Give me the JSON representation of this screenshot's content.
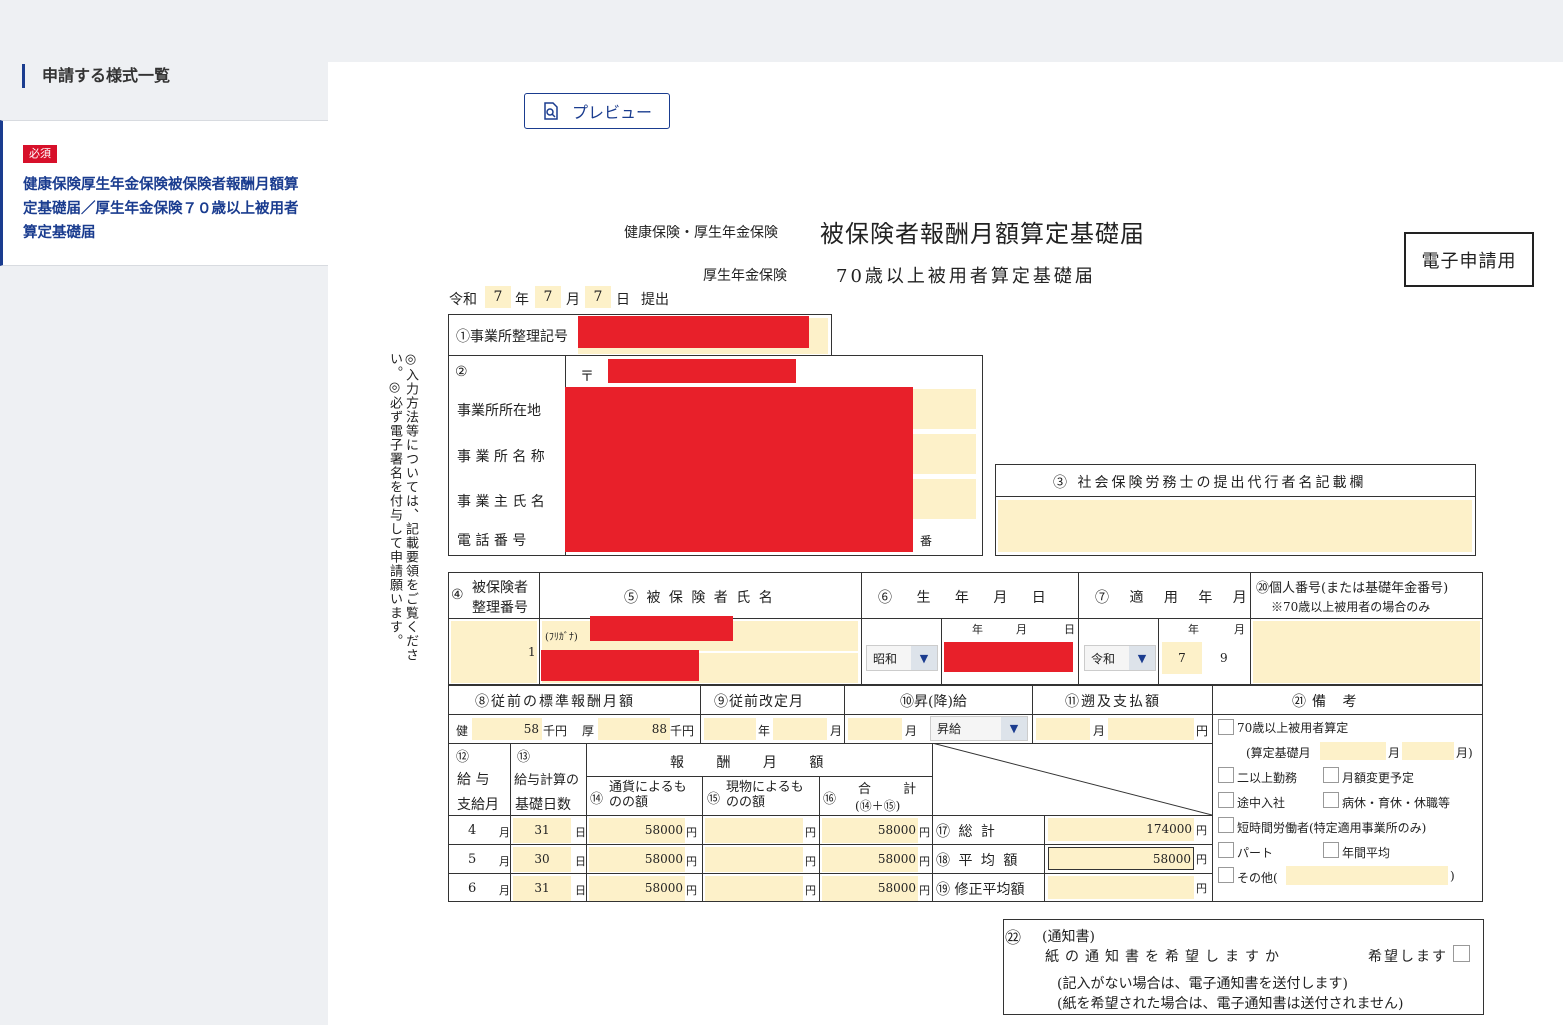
{
  "sidebar": {
    "heading": "申請する様式一覧",
    "badge": "必須",
    "form_link": "健康保険厚生年金保険被保険者報酬月額算定基礎届／厚生年金保険７０歳以上被用者算定基礎届"
  },
  "toolbar": {
    "preview_label": "プレビュー"
  },
  "form": {
    "title_prefix": "健康保険・厚生年金保険",
    "title_main": "被保険者報酬月額算定基礎届",
    "subtitle_prefix": "厚生年金保険",
    "subtitle_main": "70歳以上被用者算定基礎届",
    "e_filing_label": "電子申請用",
    "submit_date": {
      "era": "令和",
      "year": "7",
      "year_unit": "年",
      "month": "7",
      "month_unit": "月",
      "day": "7",
      "day_unit": "日",
      "suffix": "提出"
    },
    "side_note": "◎入力方法等については、記載要領をご覧ください。◎必ず電子署名を付与して申請願います。",
    "office_number_label": "①事業所整理記号",
    "section2_num": "②",
    "postal_mark": "〒",
    "office_address_label": "事業所所在地",
    "office_name_label": "事 業 所 名 称",
    "owner_name_label": "事 業 主 氏 名",
    "phone_label": "電 話 番 号",
    "phone_suffix": "番",
    "agent_label": "③ 社会保険労務士の提出代行者名記載欄",
    "col4_num": "④",
    "col4_label_1": "被保険者",
    "col4_label_2": "整理番号",
    "col5_label": "⑤ 被 保 険 者 氏 名",
    "col6_label": "⑥ 生 年 月 日",
    "col7_label": "⑦ 適 用 年 月",
    "col20_label_1": "⑳個人番号(または基礎年金番号)",
    "col20_label_2": "※70歳以上被用者の場合のみ",
    "insured_number": "1",
    "furigana_label": "(ﾌﾘｶﾞﾅ)",
    "year_unit": "年",
    "month_unit": "月",
    "day_unit": "日",
    "birth_era": "昭和",
    "apply_era": "令和",
    "apply_year": "7",
    "apply_month": "9",
    "col8_label": "⑧従前の標準報酬月額",
    "col9_label": "⑨従前改定月",
    "col10_label": "⑩昇(降)給",
    "col11_label": "⑪遡及支払額",
    "col21_label": "㉑備 考",
    "health_label": "健",
    "health_value": "58",
    "pension_label": "厚",
    "pension_value": "88",
    "thousand_yen": "千円",
    "yen": "円",
    "raise_type": "昇給",
    "col12_num": "⑫",
    "col12_label_1": "給 与",
    "col12_label_2": "支給月",
    "col13_num": "⑬",
    "col13_label_1": "給与計算の",
    "col13_label_2": "基礎日数",
    "pay_header": "報 酬 月 額",
    "col14_num": "⑭",
    "col14_label": "通貨によるものの額",
    "col15_num": "⑮",
    "col15_label": "現物によるものの額",
    "col16_num": "⑯",
    "col16_label_1": "合 計",
    "col16_label_2": "(⑭＋⑮)",
    "rows": [
      {
        "month": "4",
        "days": "31",
        "cash": "58000",
        "in_kind": "",
        "total": "58000"
      },
      {
        "month": "5",
        "days": "30",
        "cash": "58000",
        "in_kind": "",
        "total": "58000"
      },
      {
        "month": "6",
        "days": "31",
        "cash": "58000",
        "in_kind": "",
        "total": "58000"
      }
    ],
    "sum_label": "⑰ 総 計",
    "sum_value": "174000",
    "avg_label": "⑱ 平 均 額",
    "avg_value": "58000",
    "adj_avg_label": "⑲ 修正平均額",
    "adj_avg_value": "",
    "remarks": {
      "over70": "70歳以上被用者算定",
      "basis_month": "(算定基礎月",
      "month_close": "月)",
      "multiple_work": "二以上勤務",
      "monthly_change": "月額変更予定",
      "mid_entry": "途中入社",
      "leave": "病休・育休・休職等",
      "short_worker": "短時間労働者(特定適用事業所のみ)",
      "part": "パート",
      "annual_avg": "年間平均",
      "other": "その他(",
      "other_close": ")"
    },
    "notice_num": "㉒",
    "notice_title": "(通知書)",
    "notice_question": "紙の通知書を希望しますか",
    "notice_option": "希望します",
    "notice_note_1": "(記入がない場合は、電子通知書を送付します)",
    "notice_note_2": "(紙を希望された場合は、電子通知書は送付されません)"
  },
  "colors": {
    "accent": "#1a3c8f",
    "required": "#d7102a",
    "field": "#fdf1c9",
    "redaction": "#e8202a"
  }
}
